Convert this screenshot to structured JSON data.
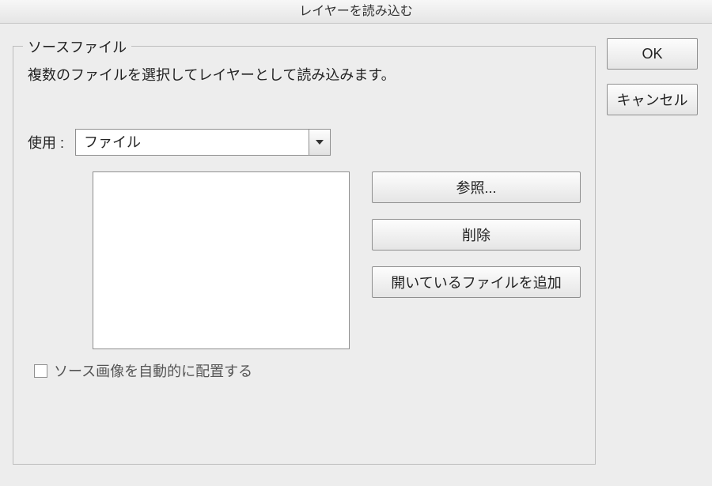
{
  "titlebar": {
    "title": "レイヤーを読み込む"
  },
  "fieldset": {
    "legend": "ソースファイル",
    "description": "複数のファイルを選択してレイヤーとして読み込みます。",
    "use_label": "使用 :",
    "use_select": {
      "value": "ファイル"
    },
    "buttons": {
      "browse": "参照...",
      "remove": "削除",
      "addopen": "開いているファイルを追加"
    },
    "checkbox_label": "ソース画像を自動的に配置する"
  },
  "side": {
    "ok": "OK",
    "cancel": "キャンセル"
  }
}
